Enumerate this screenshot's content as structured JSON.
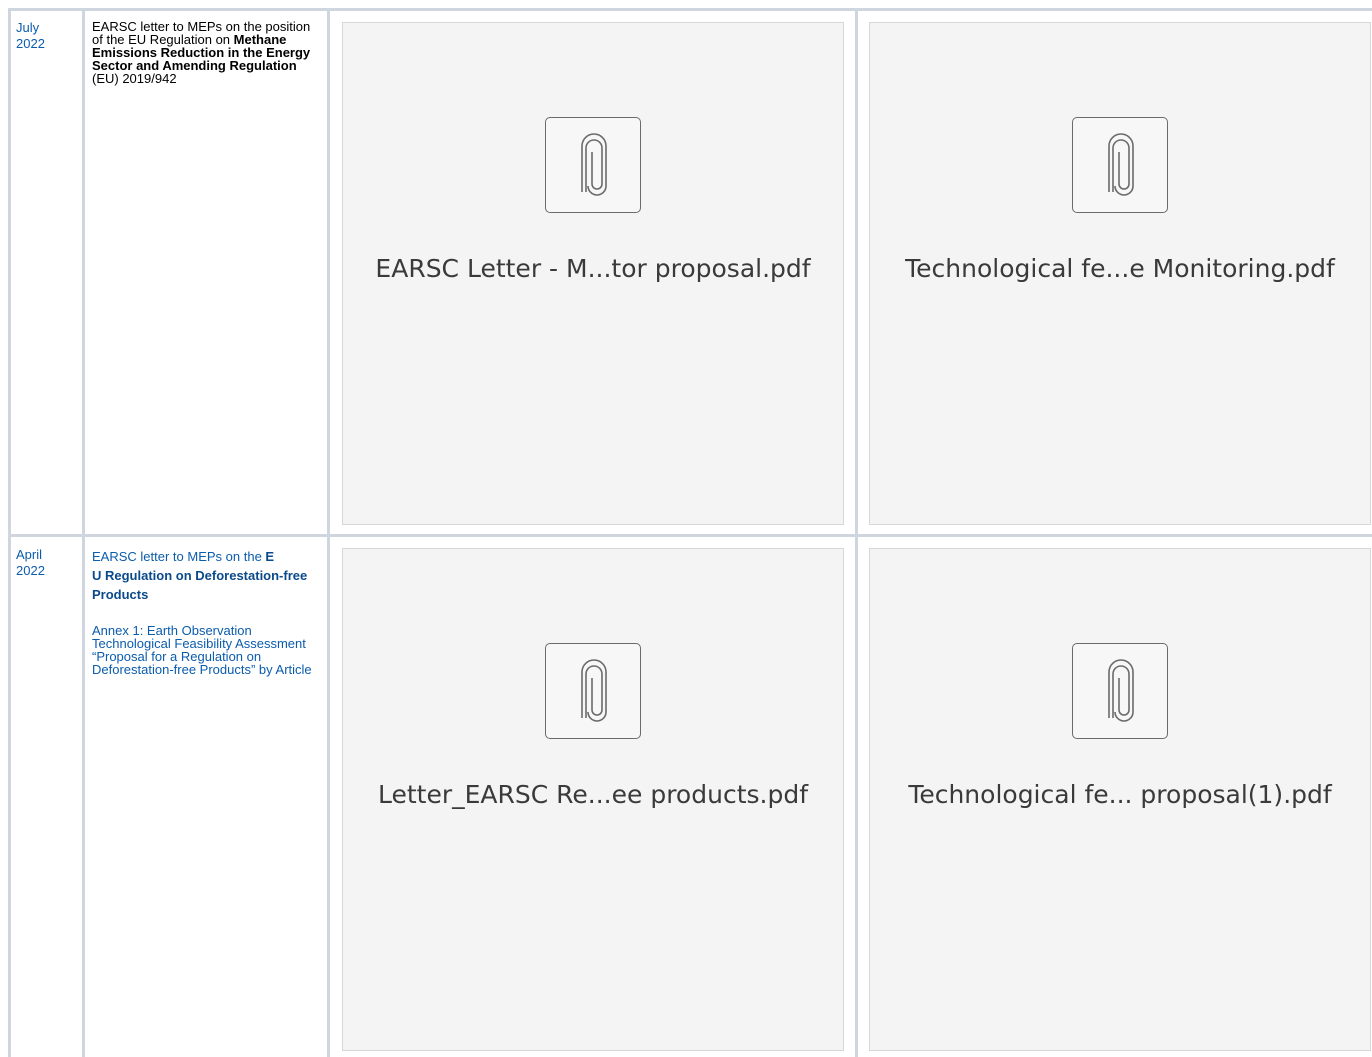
{
  "rows": [
    {
      "date_line1": "July",
      "date_line2": "2022",
      "desc_pre": "EARSC letter to MEPs on the position of the EU Regulation on ",
      "desc_bold": "Methane Emissions Reduction in the Energy Sector and Amending Regulation",
      "desc_post": " (EU) 2019/942",
      "attachments": [
        "EARSC Letter - M...tor proposal.pdf",
        "Technological fe...e Monitoring.pdf"
      ]
    },
    {
      "date_line1": "April",
      "date_line2": "2022",
      "desc_pre": "EARSC letter to MEPs on the ",
      "desc_bold_a": "E",
      "desc_bold_b": "U Regulation on Deforestation-free Products",
      "annex": "Annex 1: Earth Observation Technological Feasibility Assessment “Proposal for a Regulation on Deforestation-free Products” by Article",
      "attachments": [
        "Letter_EARSC Re...ee products.pdf",
        "Technological fe... proposal(1).pdf"
      ]
    }
  ],
  "icons": {
    "attachment": "paperclip-icon"
  },
  "colors": {
    "link": "#0b5cad",
    "grid": "#cfd6e0",
    "tile_bg": "#f4f4f4"
  }
}
